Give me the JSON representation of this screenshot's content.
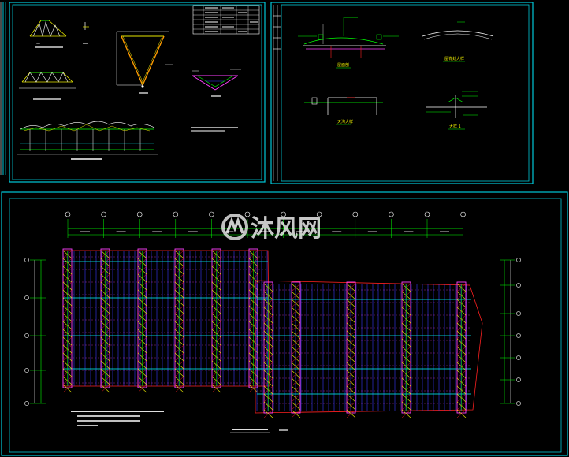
{
  "colors": {
    "background": "#000000",
    "frame": "#00c8d8",
    "yellow": "#e8e800",
    "green": "#00ff00",
    "red": "#ff2020",
    "cyan": "#00ffff",
    "blue": "#3a3aff",
    "magenta": "#ff40ff",
    "white": "#ffffff"
  },
  "watermark": {
    "text": "沐风网",
    "icon": "mufeng-logo-icon"
  },
  "detail_labels": {
    "roof_section": "屋面剖",
    "ridge_detail": "屋脊处大样",
    "gutter_detail": "天沟大样",
    "detail_1": "大样 1"
  }
}
